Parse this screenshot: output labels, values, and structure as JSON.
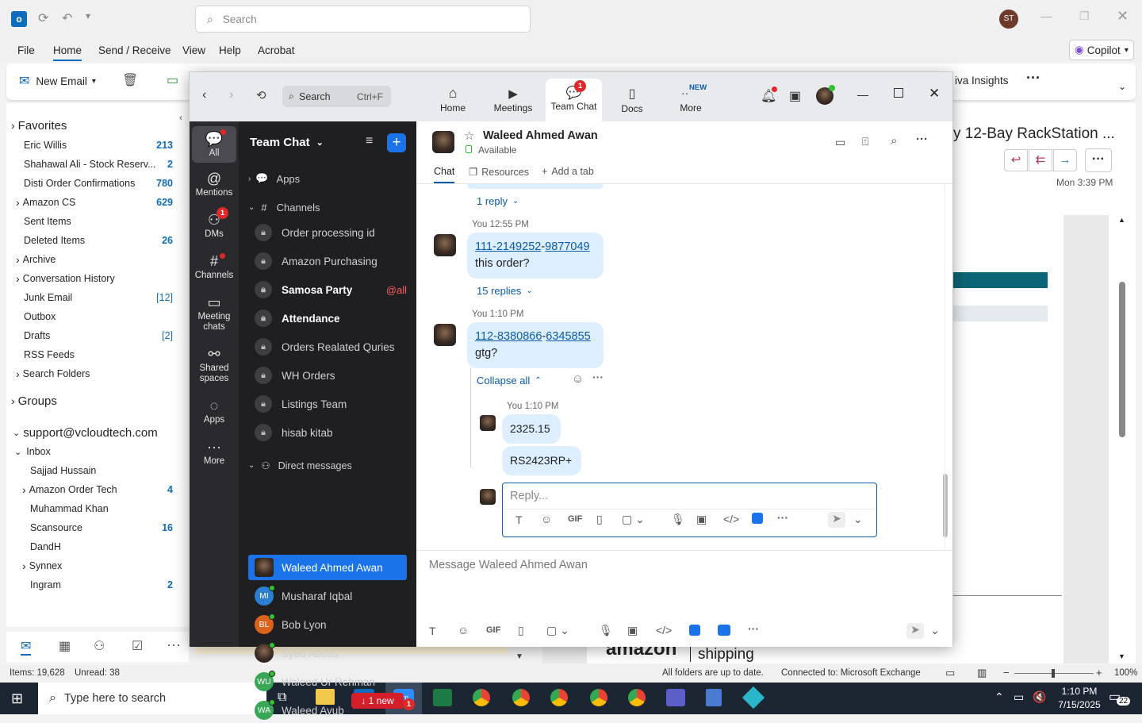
{
  "outlook": {
    "title_bar": {
      "search_placeholder": "Search",
      "user_initials": "ST"
    },
    "ribbon_tabs": [
      "File",
      "Home",
      "Send / Receive",
      "View",
      "Help",
      "Acrobat"
    ],
    "copilot_label": "Copilot",
    "ribbon": {
      "new_email": "New Email",
      "viva": "iva Insights"
    },
    "folders": [
      {
        "label": "Favorites",
        "count": "",
        "type": "header"
      },
      {
        "label": "Eric Willis",
        "count": "213"
      },
      {
        "label": "Shahawal Ali - Stock Reserv...",
        "count": "2"
      },
      {
        "label": "Disti Order Confirmations",
        "count": "780"
      },
      {
        "label": "Amazon CS",
        "count": "629",
        "expand": true
      },
      {
        "label": "Sent Items",
        "count": ""
      },
      {
        "label": "Deleted Items",
        "count": "26"
      },
      {
        "label": "Archive",
        "count": "",
        "expand": true
      },
      {
        "label": "Conversation History",
        "count": "",
        "expand": true
      },
      {
        "label": "Junk Email",
        "count": "[12]"
      },
      {
        "label": "Outbox",
        "count": ""
      },
      {
        "label": "Drafts",
        "count": "[2]"
      },
      {
        "label": "RSS Feeds",
        "count": ""
      },
      {
        "label": "Search Folders",
        "count": "",
        "expand": true
      },
      {
        "label": "Groups",
        "count": "",
        "type": "group"
      }
    ],
    "account": "support@vcloudtech.com",
    "inbox": {
      "label": "Inbox",
      "items": [
        {
          "label": "Sajjad Hussain",
          "count": ""
        },
        {
          "label": "Amazon Order Tech",
          "count": "4",
          "expand": true
        },
        {
          "label": "Muhammad Khan",
          "count": ""
        },
        {
          "label": "Scansource",
          "count": "16"
        },
        {
          "label": "DandH",
          "count": ""
        },
        {
          "label": "Synnex",
          "count": "",
          "expand": true
        },
        {
          "label": "Ingram",
          "count": "2"
        }
      ]
    },
    "reading": {
      "subject": "y 12-Bay RackStation ...",
      "date": "Mon 3:39 PM",
      "footer_brand": "amazon",
      "footer_shipping": "shipping"
    },
    "status": {
      "items": "Items: 19,628",
      "unread": "Unread: 38",
      "sync": "All folders are up to date.",
      "connection": "Connected to: Microsoft Exchange",
      "zoom": "100%"
    }
  },
  "zoom": {
    "search_placeholder": "Search",
    "search_shortcut": "Ctrl+F",
    "top_tabs": [
      {
        "label": "Home"
      },
      {
        "label": "Meetings"
      },
      {
        "label": "Team Chat",
        "badge": "1"
      },
      {
        "label": "Docs"
      },
      {
        "label": "More",
        "tag": "NEW"
      }
    ],
    "rail": [
      {
        "label": "All"
      },
      {
        "label": "Mentions"
      },
      {
        "label": "DMs",
        "badge": "1"
      },
      {
        "label": "Channels"
      },
      {
        "label": "Meeting chats"
      },
      {
        "label": "Shared spaces"
      },
      {
        "label": "Apps"
      },
      {
        "label": "More"
      }
    ],
    "list": {
      "title": "Team Chat",
      "apps_label": "Apps",
      "channels_label": "Channels",
      "channels": [
        {
          "name": "Order processing id"
        },
        {
          "name": "Amazon Purchasing"
        },
        {
          "name": "Samosa Party",
          "bold": true,
          "mention": "@all"
        },
        {
          "name": "Attendance",
          "bold": true
        },
        {
          "name": "Orders Realated Quries"
        },
        {
          "name": "WH Orders"
        },
        {
          "name": "Listings Team"
        },
        {
          "name": "hisab kitab"
        }
      ],
      "dm_label": "Direct messages",
      "dms": [
        {
          "name": "Waleed Ahmed Awan",
          "initials": "",
          "color": "#6b5444",
          "selected": true
        },
        {
          "name": "Musharaf Iqbal",
          "initials": "MI",
          "color": "#2d7fd3"
        },
        {
          "name": "Bob Lyon",
          "initials": "BL",
          "color": "#d9621c"
        },
        {
          "name": "Syed Abbas",
          "initials": "",
          "color": "#333333"
        },
        {
          "name": "Waleed Ur Rehman",
          "initials": "WU",
          "color": "#3aa757"
        },
        {
          "name": "Waleed Ayub",
          "initials": "WA",
          "color": "#3aa757"
        }
      ],
      "new_pill": "↓ 1 new"
    },
    "chat": {
      "contact": "Waleed Ahmed Awan",
      "status": "Available",
      "tabs": [
        "Chat",
        "Resources",
        "Add a tab"
      ],
      "reply_link_1": "1 reply",
      "msg1": {
        "sender": "You",
        "time": "12:55 PM",
        "link_a": "111-2149252",
        "sep": "-",
        "link_b": "9877049",
        "text": "this order?"
      },
      "replies_link": "15 replies",
      "msg2": {
        "sender": "You",
        "time": "1:10 PM",
        "link_a": "112-8380866",
        "sep": "-",
        "link_b": "6345855",
        "text": "gtg?"
      },
      "collapse": "Collapse all",
      "thread": {
        "sender": "You",
        "time": "1:10 PM",
        "msgs": [
          "2325.15",
          "RS2423RP+"
        ]
      },
      "reply_placeholder": "Reply...",
      "composer_placeholder": "Message Waleed Ahmed Awan"
    }
  },
  "taskbar": {
    "search_placeholder": "Type here to search",
    "time": "1:10 PM",
    "date": "7/15/2025",
    "notif": "22"
  }
}
